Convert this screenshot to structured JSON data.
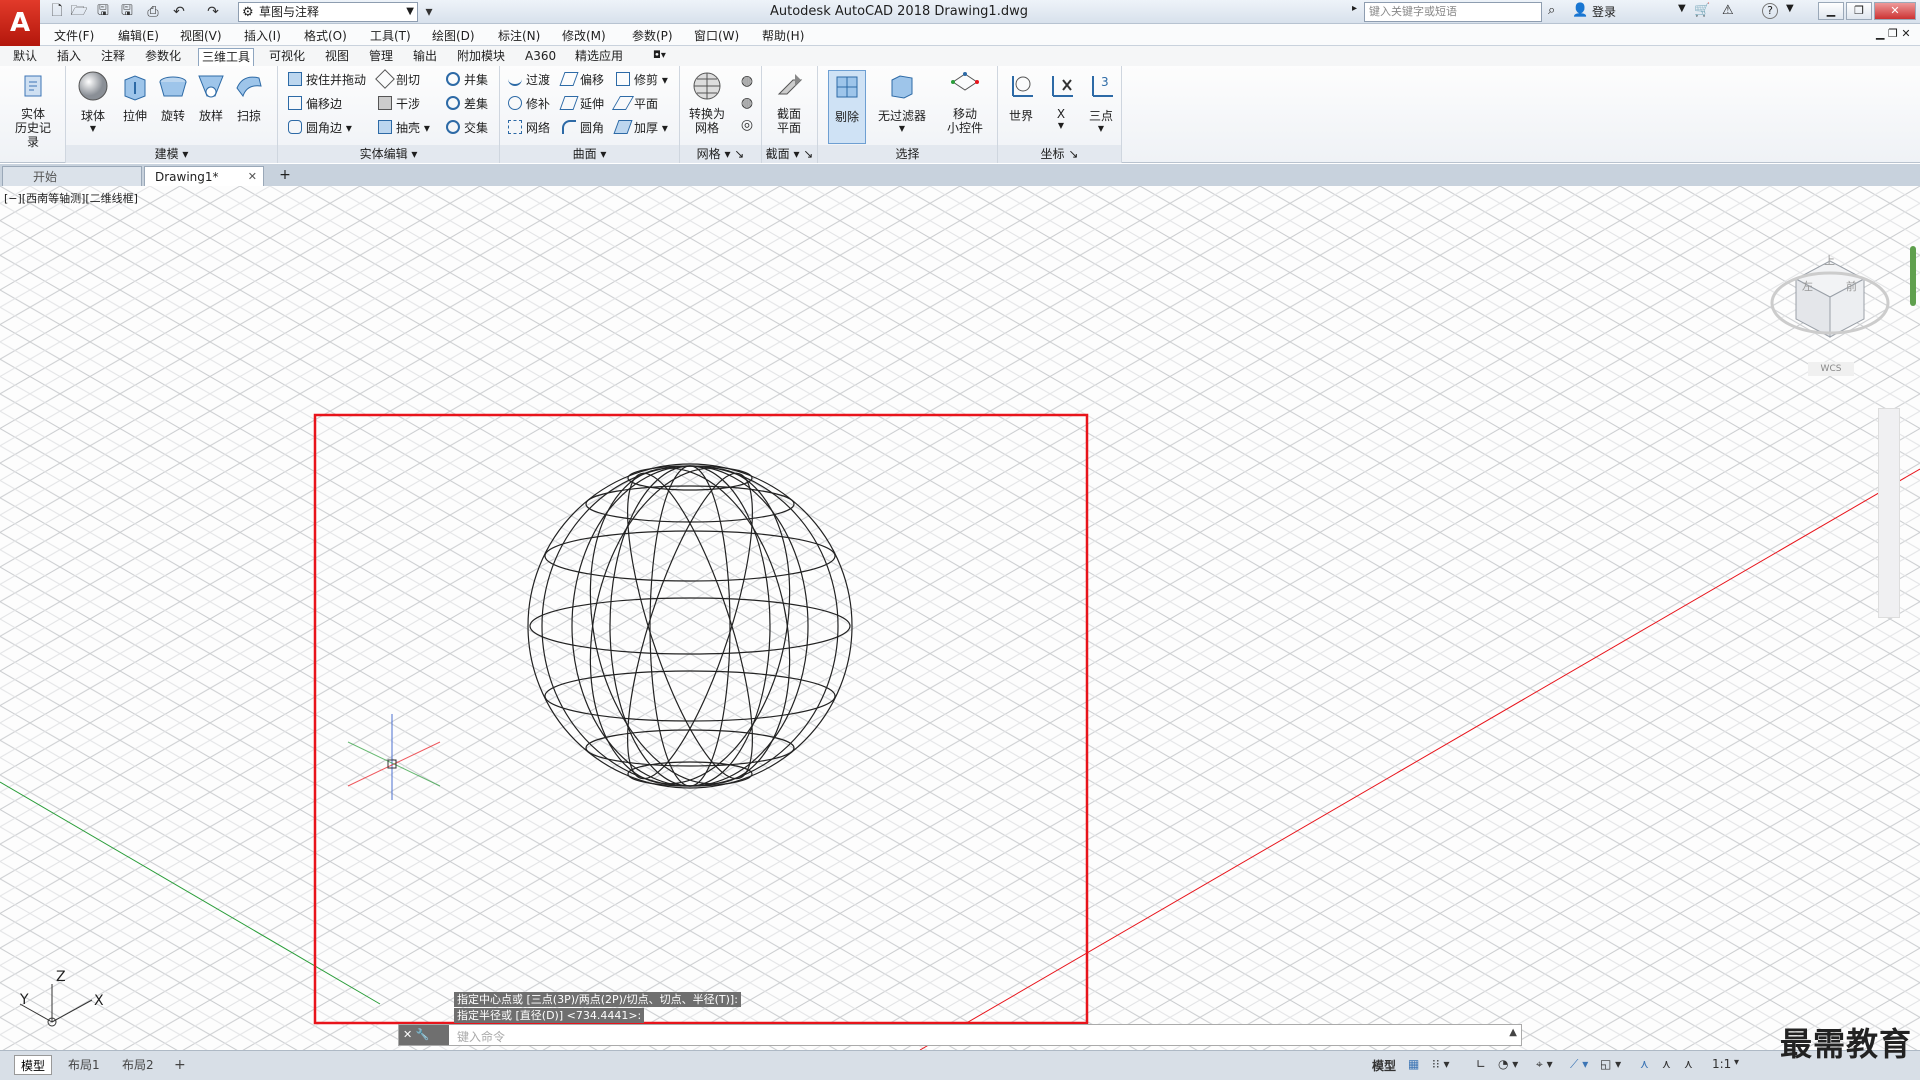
{
  "titlebar": {
    "workspace": "草图与注释",
    "title": "Autodesk AutoCAD 2018    Drawing1.dwg",
    "search_placeholder": "键入关键字或短语",
    "login": "登录",
    "help": "?"
  },
  "menu": [
    "文件(F)",
    "编辑(E)",
    "视图(V)",
    "插入(I)",
    "格式(O)",
    "工具(T)",
    "绘图(D)",
    "标注(N)",
    "修改(M)",
    "参数(P)",
    "窗口(W)",
    "帮助(H)"
  ],
  "ribbon_tabs": [
    "默认",
    "插入",
    "注释",
    "参数化",
    "三维工具",
    "可视化",
    "视图",
    "管理",
    "输出",
    "附加模块",
    "A360",
    "精选应用"
  ],
  "ribbon": {
    "history": "实体\n历史记录",
    "modeling": {
      "title": "建模",
      "buttons": [
        "球体",
        "拉伸",
        "旋转",
        "放样",
        "扫掠"
      ]
    },
    "solid_edit": {
      "title": "实体编辑",
      "items": [
        "按住并拖动",
        "剖切",
        "并集",
        "偏移边",
        "干涉",
        "差集",
        "圆角边",
        "抽壳",
        "交集"
      ]
    },
    "surface": {
      "title": "曲面",
      "items": [
        "过渡",
        "偏移",
        "修剪",
        "修补",
        "延伸",
        "平面",
        "网络",
        "圆角",
        "加厚"
      ]
    },
    "mesh": {
      "title": "网格",
      "button": "转换为\n网格"
    },
    "section": {
      "title": "截面",
      "button": "截面\n平面"
    },
    "selection": {
      "title": "选择",
      "buttons": [
        "剔除",
        "无过滤器",
        "移动\n小控件"
      ]
    },
    "coords": {
      "title": "坐标",
      "buttons": [
        "世界",
        "X",
        "三点"
      ]
    }
  },
  "file_tabs": {
    "start": "开始",
    "drawing": "Drawing1*"
  },
  "viewport": {
    "label": "[−][西南等轴测][二维线框]",
    "viewcube": {
      "top": "上",
      "left": "左",
      "front": "前",
      "wcs": "WCS"
    },
    "ucs": {
      "x": "X",
      "y": "Y",
      "z": "Z"
    },
    "cmd_history": [
      "指定中心点或 [三点(3P)/两点(2P)/切点、切点、半径(T)]:",
      "指定半径或 [直径(D)] <734.4441>:"
    ],
    "cmd_placeholder": "键入命令"
  },
  "statusbar": {
    "layouts": [
      "模型",
      "布局1",
      "布局2"
    ],
    "model": "模型",
    "scale": "1:1"
  },
  "watermark": "最需教育",
  "colors": {
    "highlight": "#e8141b",
    "accent": "#3c75b5"
  }
}
